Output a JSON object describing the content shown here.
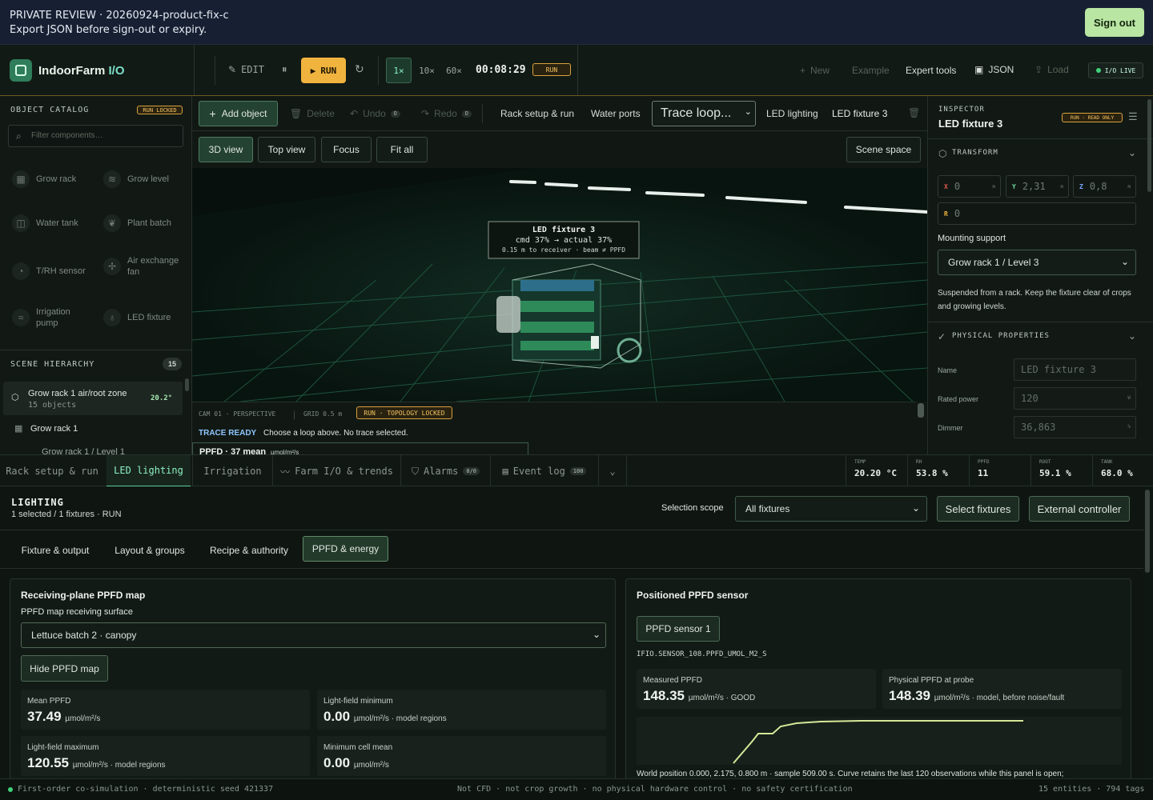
{
  "banner": {
    "line1": "PRIVATE REVIEW · 20260924-product-fix-c",
    "line2": "Export JSON before sign-out or expiry.",
    "signout": "Sign out"
  },
  "topbar": {
    "brand": "IndoorFarm",
    "brand_suffix": "I/O",
    "edit": "EDIT",
    "run": "RUN",
    "speeds": [
      "1×",
      "10×",
      "60×"
    ],
    "timer": "00:08:29",
    "run_badge": "RUN",
    "new": "New",
    "example": "Example",
    "expert": "Expert tools",
    "json": "JSON",
    "load": "Load",
    "live": "I/O LIVE"
  },
  "catalog": {
    "title": "OBJECT CATALOG",
    "badge": "RUN LOCKED",
    "filter_placeholder": "Filter components…",
    "items": [
      "Grow rack",
      "Grow level",
      "Water tank",
      "Plant batch",
      "T/RH sensor",
      "Air exchange fan",
      "Irrigation pump",
      "LED fixture"
    ]
  },
  "hierarchy": {
    "title": "SCENE HIERARCHY",
    "count": "15",
    "row1_title": "Grow rack 1 air/root zone",
    "row1_sub": "15 objects",
    "row1_temp": "20.2°",
    "row2": "Grow rack 1",
    "row3": "Grow rack 1 / Level 1"
  },
  "toolbar": {
    "add": "Add object",
    "delete": "Delete",
    "undo": "Undo",
    "undo_count": "0",
    "redo": "Redo",
    "redo_count": "0",
    "rack": "Rack setup & run",
    "water": "Water ports",
    "trace": "Trace loop...",
    "led": "LED lighting",
    "fixture": "LED fixture 3"
  },
  "views": {
    "v3d": "3D view",
    "top": "Top view",
    "focus": "Focus",
    "fit": "Fit all",
    "scene": "Scene space"
  },
  "viewport": {
    "tip_title": "LED fixture 3",
    "tip_line2": "cmd 37% → actual 37%",
    "tip_line3": "0.15 m to receiver · beam ≠ PPFD",
    "cam": "CAM 01 · PERSPECTIVE",
    "grid": "GRID 0.5 m",
    "topo": "RUN · TOPOLOGY LOCKED",
    "trace_label": "TRACE READY",
    "trace_text": "Choose a loop above. No trace selected.",
    "ppfd_peek": "PPFD · 37 mean",
    "ppfd_unit": "µmol/m²/s"
  },
  "inspector": {
    "title": "INSPECTOR",
    "badge": "RUN · READ ONLY",
    "object": "LED fixture 3",
    "transform": "TRANSFORM",
    "x": "0",
    "y": "2,31",
    "z": "0,8",
    "r": "0",
    "x_label": "X",
    "y_label": "Y",
    "z_label": "Z",
    "r_label": "R",
    "unit": "m",
    "mount_label": "Mounting support",
    "mount_value": "Grow rack 1 / Level 3",
    "mount_note": "Suspended from a rack. Keep the fixture clear of crops and growing levels.",
    "physical": "PHYSICAL PROPERTIES",
    "name_label": "Name",
    "name_value": "LED fixture 3",
    "power_label": "Rated power",
    "power_value": "120",
    "power_unit": "W",
    "dimmer_label": "Dimmer",
    "dimmer_value": "36,863",
    "dimmer_unit": "%"
  },
  "tabs": {
    "rack": "Rack setup & run",
    "led": "LED lighting",
    "irrigation": "Irrigation",
    "farm": "Farm I/O & trends",
    "alarms": "Alarms",
    "alarms_count": "0/0",
    "events": "Event log",
    "events_count": "100"
  },
  "metrics": [
    {
      "k": "TEMP",
      "v": "20.20 °C"
    },
    {
      "k": "RH",
      "v": "53.8 %"
    },
    {
      "k": "PPFD",
      "v": "11"
    },
    {
      "k": "ROOT",
      "v": "59.1 %"
    },
    {
      "k": "TANK",
      "v": "68.0 %"
    }
  ],
  "lighting": {
    "title": "LIGHTING",
    "subtitle": "1 selected / 1 fixtures · RUN",
    "scope_label": "Selection scope",
    "scope_value": "All fixtures",
    "select_btn": "Select fixtures",
    "external_btn": "External controller",
    "subtabs": [
      "Fixture & output",
      "Layout & groups",
      "Recipe & authority",
      "PPFD & energy"
    ]
  },
  "map": {
    "title": "Receiving-plane PPFD map",
    "surface_label": "PPFD map receiving surface",
    "surface_value": "Lettuce batch 2 · canopy",
    "hide_btn": "Hide PPFD map",
    "kpis": [
      {
        "k": "Mean PPFD",
        "v": "37.49",
        "u": "µmol/m²/s"
      },
      {
        "k": "Light-field minimum",
        "v": "0.00",
        "u": "µmol/m²/s · model regions"
      },
      {
        "k": "Light-field maximum",
        "v": "120.55",
        "u": "µmol/m²/s · model regions"
      },
      {
        "k": "Minimum cell mean",
        "v": "0.00",
        "u": "µmol/m²/s"
      }
    ]
  },
  "sensor": {
    "title": "Positioned PPFD sensor",
    "btn": "PPFD sensor 1",
    "tag": "IFIO.SENSOR_108.PPFD_UMOL_M2_S",
    "measured_label": "Measured PPFD",
    "measured_value": "148.35",
    "measured_unit": "µmol/m²/s · GOOD",
    "physical_label": "Physical PPFD at probe",
    "physical_value": "148.39",
    "physical_unit": "µmol/m²/s · model, before noise/fault",
    "footer": "World position 0.000, 2.175, 0.800 m · sample 509.00 s. Curve retains the last 120 observations while this panel is open;"
  },
  "status": {
    "left": "First-order co-simulation · deterministic seed 421337",
    "middle": "Not CFD · not crop growth · no physical hardware control · no safety certification",
    "right": "15 entities · 794 tags"
  },
  "colors": {
    "accent": "#8cf0c0",
    "run": "#f0b43e",
    "trace": "#d8e89a",
    "signout": "#b9e6a2"
  }
}
